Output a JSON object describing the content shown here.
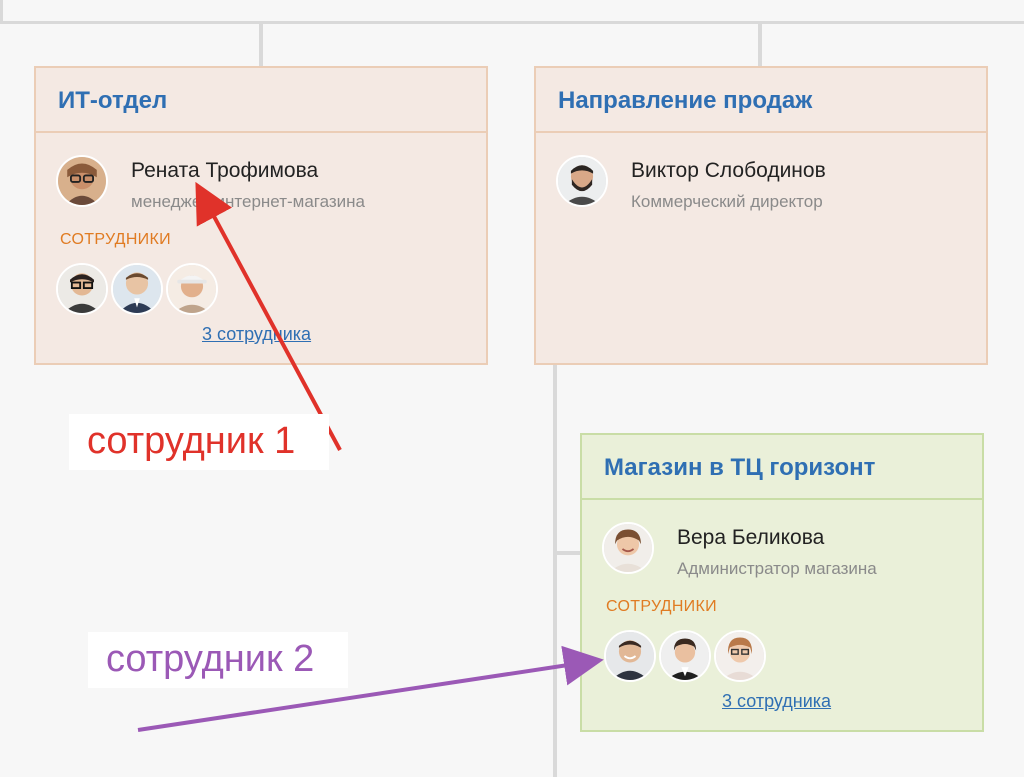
{
  "departments": [
    {
      "title": "ИТ-отдел",
      "head": {
        "name": "Рената Трофимова",
        "role": "менеджер интернет-магазина",
        "avatar_icon": "woman-with-glasses-avatar"
      },
      "staff_label": "СОТРУДНИКИ",
      "staff_link": "3 сотрудника",
      "staff_avatars": [
        "man-with-glasses-avatar",
        "man-in-suit-avatar",
        "man-in-cap-avatar"
      ]
    },
    {
      "title": "Направление продаж",
      "head": {
        "name": "Виктор Слободинов",
        "role": "Коммерческий директор",
        "avatar_icon": "bearded-man-avatar"
      }
    },
    {
      "title": "Магазин в ТЦ горизонт",
      "head": {
        "name": "Вера Беликова",
        "role": "Администратор магазина",
        "avatar_icon": "smiling-woman-avatar"
      },
      "staff_label": "СОТРУДНИКИ",
      "staff_link": "3 сотрудника",
      "staff_avatars": [
        "smiling-man-avatar",
        "woman-with-braid-avatar",
        "woman-with-glasses-avatar"
      ]
    }
  ],
  "annotations": {
    "note1": "сотрудник 1",
    "note2": "сотрудник 2",
    "color1": "#e0322a",
    "color2": "#9b59b6"
  },
  "colors": {
    "title_blue": "#2f6fb3",
    "staff_orange": "#e07b22",
    "card_peach": "#f4e9e3",
    "card_green": "#eaf0d9"
  }
}
